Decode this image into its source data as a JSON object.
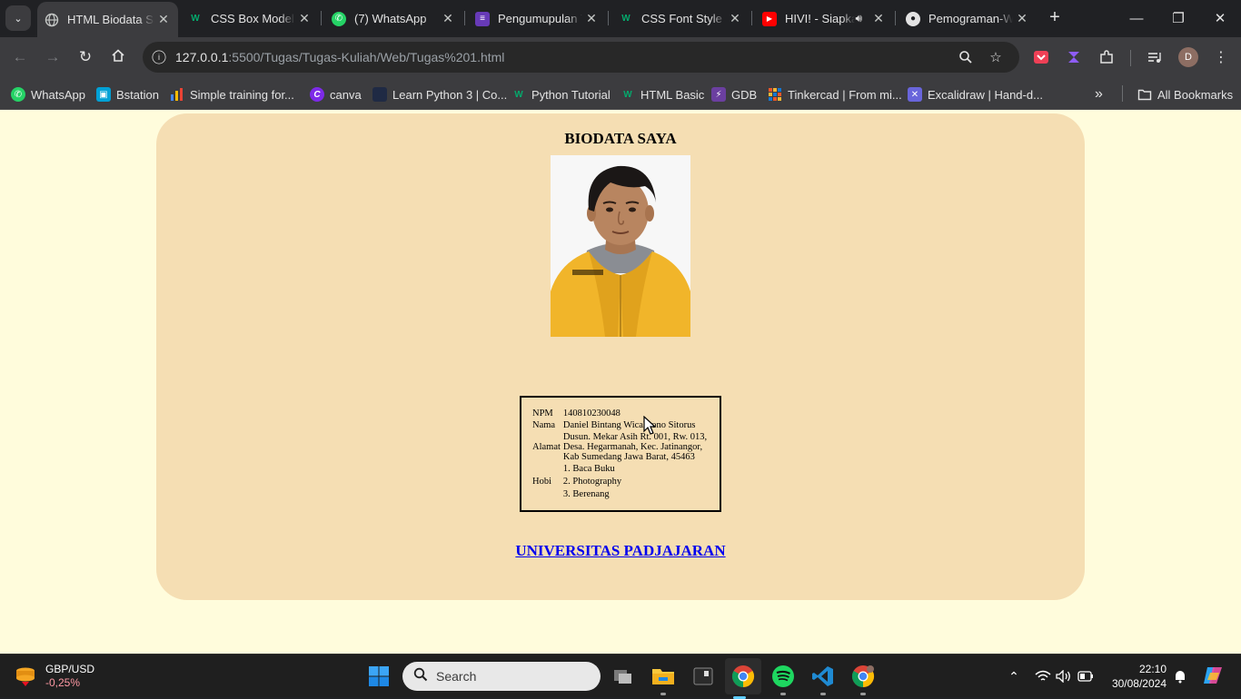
{
  "tabs": [
    {
      "title": "HTML Biodata Saya",
      "favicon": "globe-icon",
      "active": true
    },
    {
      "title": "CSS Box Model",
      "favicon": "w3schools-icon",
      "active": false
    },
    {
      "title": "(7) WhatsApp",
      "favicon": "whatsapp-icon",
      "active": false
    },
    {
      "title": "Pengumupulan Tugas",
      "favicon": "classroom-icon",
      "active": false
    },
    {
      "title": "CSS Font Style",
      "favicon": "w3schools-icon",
      "active": false
    },
    {
      "title": "HIVI! - Siapkah Kau",
      "favicon": "youtube-icon",
      "active": false,
      "audio": true
    },
    {
      "title": "Pemograman-Web",
      "favicon": "github-icon",
      "active": false
    }
  ],
  "address": {
    "host": "127.0.0.1",
    "path": ":5500/Tugas/Tugas-Kuliah/Web/Tugas%201.html"
  },
  "profile_initial": "D",
  "bookmarks": [
    {
      "label": "WhatsApp"
    },
    {
      "label": "Bstation"
    },
    {
      "label": "Simple training for..."
    },
    {
      "label": "canva"
    },
    {
      "label": "Learn Python 3 | Co..."
    },
    {
      "label": "Python Tutorial"
    },
    {
      "label": "HTML Basic"
    },
    {
      "label": "GDB"
    },
    {
      "label": "Tinkercad | From mi..."
    },
    {
      "label": "Excalidraw | Hand-d..."
    }
  ],
  "bookmarks_more": "»",
  "all_bookmarks_label": "All Bookmarks",
  "page": {
    "title": "BIODATA SAYA",
    "bio": {
      "npm_label": "NPM",
      "npm": "140810230048",
      "nama_label": "Nama",
      "nama": "Daniel Bintang Wicaksono Sitorus",
      "alamat_label": "Alamat",
      "alamat_line1": "Dusun. Mekar Asih Rt. 001, Rw. 013,",
      "alamat_line2": "Desa. Hegarmanah, Kec. Jatinangor,",
      "alamat_line3": "Kab Sumedang Jawa Barat, 45463",
      "hobi_label": "Hobi",
      "hobi": [
        "1. Baca Buku",
        "2. Photography",
        "3. Berenang"
      ]
    },
    "link_text": "UNIVERSITAS PADJAJARAN"
  },
  "taskbar": {
    "widget_name": "GBP/USD",
    "widget_value": "-0,25%",
    "search_placeholder": "Search",
    "time": "22:10",
    "date": "30/08/2024"
  },
  "colors": {
    "page_bg": "#fffcdc",
    "card_bg": "#f5deb3",
    "link": "#0000ee",
    "chrome_dark": "#202124",
    "chrome_toolbar": "#3c3c3f"
  }
}
